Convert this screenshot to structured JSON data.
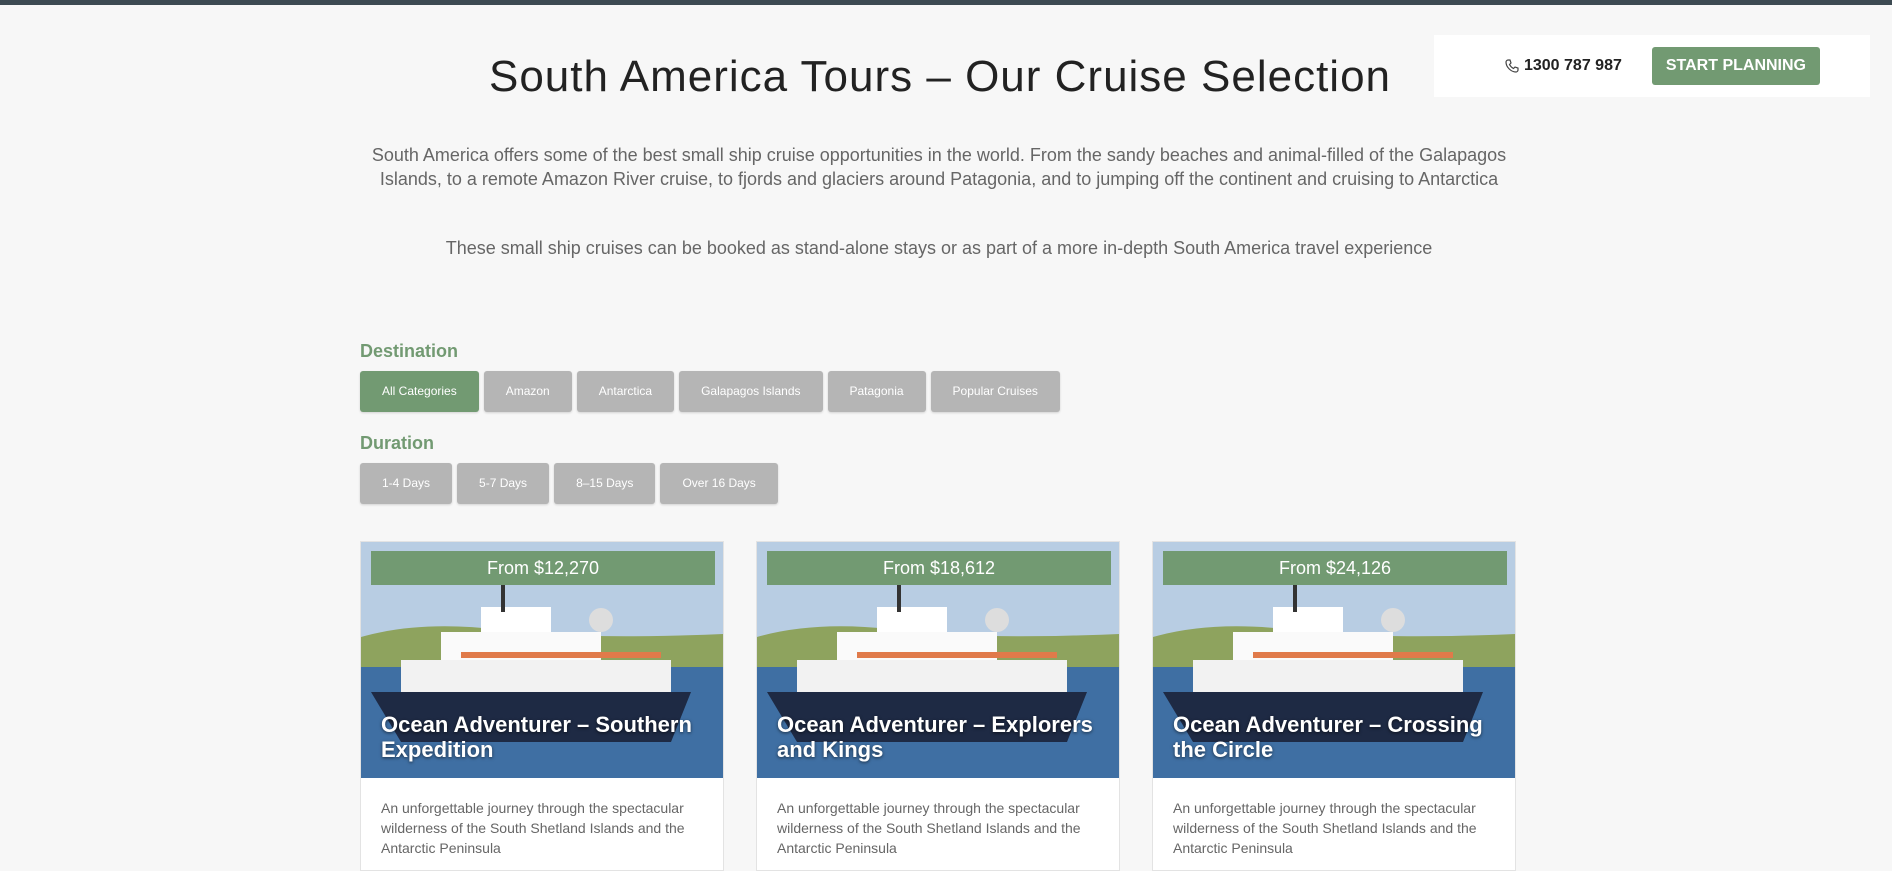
{
  "header": {
    "phone": "1300 787 987",
    "cta_label": "START PLANNING"
  },
  "page": {
    "title": "South America Tours – Our Cruise Selection",
    "intro": "South America offers some of the best small ship cruise opportunities in the world. From the sandy beaches and animal-filled of the Galapagos Islands, to a remote Amazon River cruise, to fjords and glaciers around Patagonia, and to jumping off the continent and cruising to Antarctica",
    "intro2": "These small ship cruises can be booked as stand-alone stays or as part of a more in-depth South America travel experience"
  },
  "filters": {
    "destination_label": "Destination",
    "destinations": [
      "All Categories",
      "Amazon",
      "Antarctica",
      "Galapagos Islands",
      "Patagonia",
      "Popular Cruises"
    ],
    "duration_label": "Duration",
    "durations": [
      "1-4 Days",
      "5-7 Days",
      "8–15 Days",
      "Over 16 Days"
    ]
  },
  "cards": [
    {
      "price": "From $12,270",
      "title": "Ocean Adventurer – Southern Expedition",
      "desc": "An unforgettable journey through the spectacular wilderness of the South Shetland Islands and the Antarctic Peninsula"
    },
    {
      "price": "From $18,612",
      "title": "Ocean Adventurer – Explorers and Kings",
      "desc": "An unforgettable journey through the spectacular wilderness of the South Shetland Islands and the Antarctic Peninsula"
    },
    {
      "price": "From $24,126",
      "title": "Ocean Adventurer – Crossing the Circle",
      "desc": "An unforgettable journey through the spectacular wilderness of the South Shetland Islands and the Antarctic Peninsula"
    }
  ],
  "colors": {
    "accent": "#729a72",
    "chip_inactive": "#b5b5b5",
    "topbar": "#3d4a52"
  }
}
